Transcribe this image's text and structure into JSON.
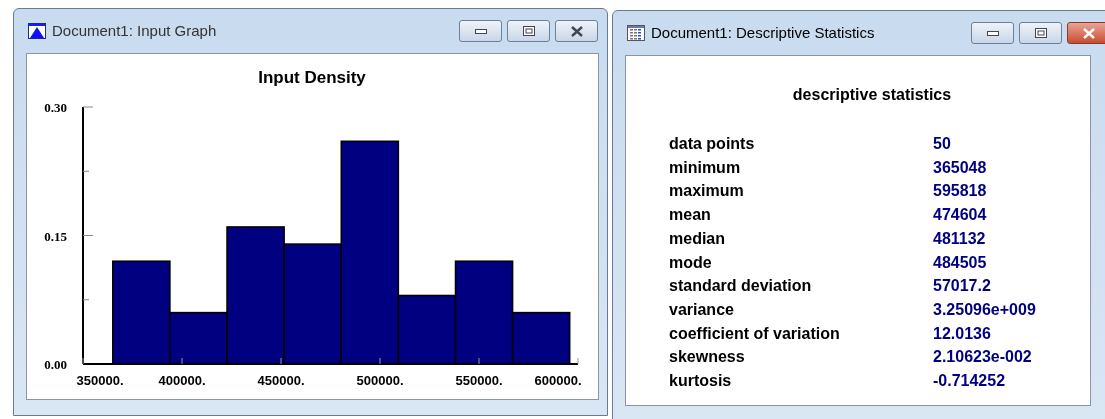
{
  "windows": [
    {
      "kind": "graph",
      "title": "Document1: Input Graph",
      "active": false,
      "chart_data": {
        "type": "bar",
        "title": "Input Density",
        "x": [
          379471,
          408317,
          437164,
          466010,
          494856,
          523702,
          552548,
          581395
        ],
        "series": [
          {
            "color": "#000080",
            "values": [
              0.12,
              0.06,
              0.16,
              0.14,
              0.26,
              0.08,
              0.12,
              0.06
            ]
          }
        ],
        "xlim": [
          350000,
          600000
        ],
        "ylim": [
          0,
          0.3
        ],
        "xticks": [
          {
            "value": 350000,
            "label": "350000."
          },
          {
            "value": 400000,
            "label": "400000."
          },
          {
            "value": 450000,
            "label": "450000."
          },
          {
            "value": 500000,
            "label": "500000."
          },
          {
            "value": 550000,
            "label": "550000."
          },
          {
            "value": 600000,
            "label": "600000."
          }
        ],
        "yticks": [
          {
            "value": 0,
            "label": "0.00"
          },
          {
            "value": 0.15,
            "label": "0.15"
          },
          {
            "value": 0.3,
            "label": "0.30"
          }
        ]
      }
    },
    {
      "kind": "stats",
      "title": "Document1: Descriptive Statistics",
      "active": true,
      "heading": "descriptive statistics",
      "rows": [
        {
          "label": "data points",
          "value": "50"
        },
        {
          "label": "minimum",
          "value": "365048"
        },
        {
          "label": "maximum",
          "value": "595818"
        },
        {
          "label": "mean",
          "value": "474604"
        },
        {
          "label": "median",
          "value": "481132"
        },
        {
          "label": "mode",
          "value": "484505"
        },
        {
          "label": "standard deviation",
          "value": "57017.2"
        },
        {
          "label": "variance",
          "value": "3.25096e+009"
        },
        {
          "label": "coefficient of variation",
          "value": "12.0136"
        },
        {
          "label": "skewness",
          "value": "2.10623e-002"
        },
        {
          "label": "kurtosis",
          "value": "-0.714252"
        }
      ]
    }
  ]
}
